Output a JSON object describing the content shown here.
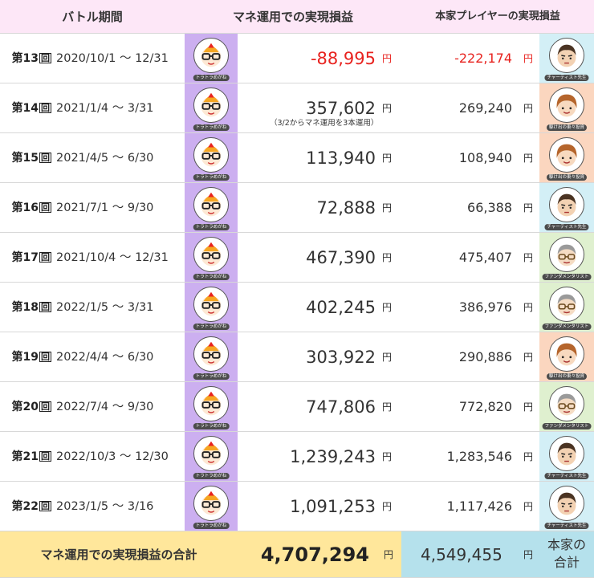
{
  "header": {
    "period": "バトル期間",
    "mane_pl": "マネ運用での実現損益",
    "player_pl": "本家プレイヤーの実現損益"
  },
  "colors": {
    "header_bg": "#fde7f7",
    "mane_avatar_bg": "#ccaff0",
    "negative": "#e8231f",
    "total_left_bg": "#ffe79b",
    "total_right_bg": "#b5e1ec"
  },
  "mane_player": {
    "tag": "トラトラめがね",
    "icon": "glasses-tiger-avatar-icon"
  },
  "rows": [
    {
      "round": "第13",
      "mark": "回",
      "period": "2020/10/1 ～ 12/31",
      "mane_value": "-88,995",
      "mane_yen": "円",
      "player_value": "-222,174",
      "player_yen": "円",
      "player_tag": "チャーティスト先生",
      "player_icon": "chartist-avatar-icon",
      "player_color": "blue",
      "negative": true
    },
    {
      "round": "第14",
      "mark": "回",
      "period": "2021/1/4 ～ 3/31",
      "mane_value": "357,602",
      "mane_yen": "円",
      "note": "（3/2からマネ運用を3本運用）",
      "player_value": "269,240",
      "player_yen": "円",
      "player_tag": "駆け出の東々投資",
      "player_icon": "beginner-avatar-icon",
      "player_color": "orange"
    },
    {
      "round": "第15",
      "mark": "回",
      "period": "2021/4/5 ～ 6/30",
      "mane_value": "113,940",
      "mane_yen": "円",
      "player_value": "108,940",
      "player_yen": "円",
      "player_tag": "駆け出の東々投資",
      "player_icon": "beginner-avatar-icon",
      "player_color": "orange"
    },
    {
      "round": "第16",
      "mark": "回",
      "period": "2021/7/1 ～ 9/30",
      "mane_value": "72,888",
      "mane_yen": "円",
      "player_value": "66,388",
      "player_yen": "円",
      "player_tag": "チャーティスト先生",
      "player_icon": "chartist-avatar-icon",
      "player_color": "blue"
    },
    {
      "round": "第17",
      "mark": "回",
      "period": "2021/10/4 ～ 12/31",
      "mane_value": "467,390",
      "mane_yen": "円",
      "player_value": "475,407",
      "player_yen": "円",
      "player_tag": "ファンダメンタリスト",
      "player_icon": "fundamentalist-avatar-icon",
      "player_color": "green"
    },
    {
      "round": "第18",
      "mark": "回",
      "period": "2022/1/5 ～ 3/31",
      "mane_value": "402,245",
      "mane_yen": "円",
      "player_value": "386,976",
      "player_yen": "円",
      "player_tag": "ファンダメンタリスト",
      "player_icon": "fundamentalist-avatar-icon",
      "player_color": "green"
    },
    {
      "round": "第19",
      "mark": "回",
      "period": "2022/4/4 ～ 6/30",
      "mane_value": "303,922",
      "mane_yen": "円",
      "player_value": "290,886",
      "player_yen": "円",
      "player_tag": "駆け出の東々投資",
      "player_icon": "beginner-avatar-icon",
      "player_color": "orange"
    },
    {
      "round": "第20",
      "mark": "回",
      "period": "2022/7/4 ～ 9/30",
      "mane_value": "747,806",
      "mane_yen": "円",
      "player_value": "772,820",
      "player_yen": "円",
      "player_tag": "ファンダメンタリスト",
      "player_icon": "fundamentalist-avatar-icon",
      "player_color": "green"
    },
    {
      "round": "第21",
      "mark": "回",
      "period": "2022/10/3 ～ 12/30",
      "mane_value": "1,239,243",
      "mane_yen": "円",
      "player_value": "1,283,546",
      "player_yen": "円",
      "player_tag": "チャーティスト先生",
      "player_icon": "chartist-avatar-icon",
      "player_color": "blue"
    },
    {
      "round": "第22",
      "mark": "回",
      "period": "2023/1/5 ～ 3/16",
      "mane_value": "1,091,253",
      "mane_yen": "円",
      "player_value": "1,117,426",
      "player_yen": "円",
      "player_tag": "チャーティスト先生",
      "player_icon": "chartist-avatar-icon",
      "player_color": "blue"
    }
  ],
  "footer": {
    "label": "マネ運用での実現損益の合計",
    "mane_total": "4,707,294",
    "mane_yen": "円",
    "player_total": "4,549,455",
    "player_yen": "円",
    "player_label_line1": "本家の",
    "player_label_line2": "合計"
  }
}
